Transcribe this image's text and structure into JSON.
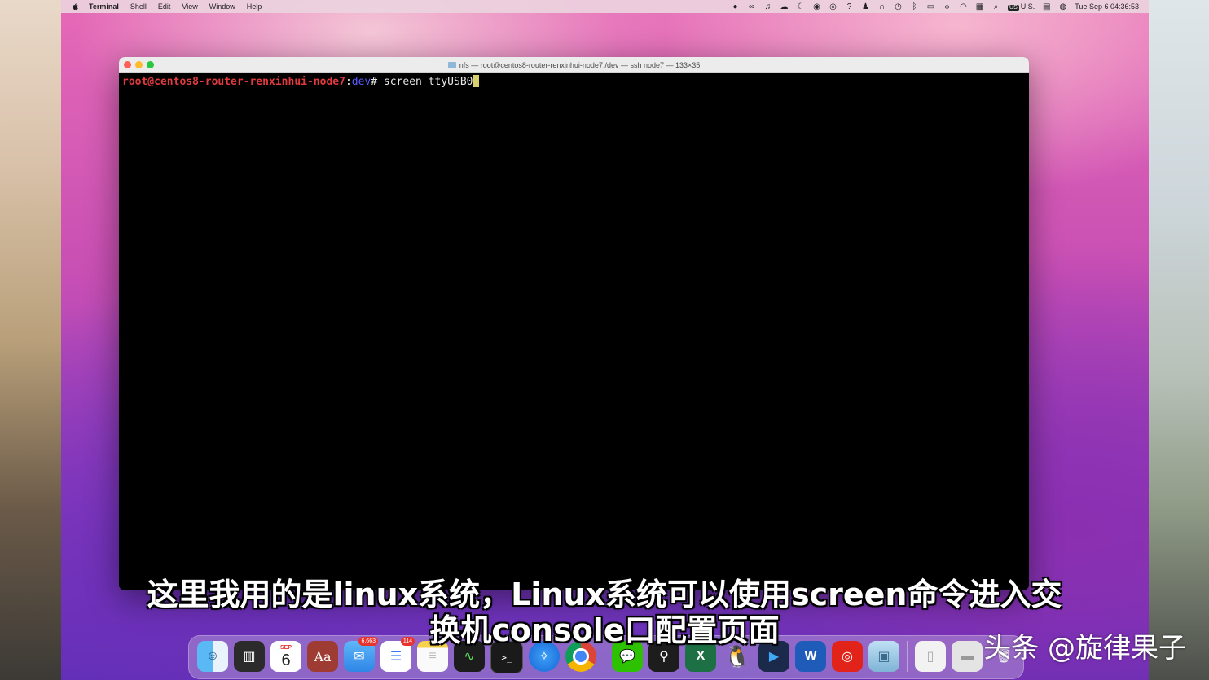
{
  "menubar": {
    "app_name": "Terminal",
    "menus": [
      "Shell",
      "Edit",
      "View",
      "Window",
      "Help"
    ],
    "input_source": "U.S.",
    "input_badge": "US",
    "datetime": "Tue Sep 6  04:36:53"
  },
  "window": {
    "title": "nfs — root@centos8-router-renxinhui-node7:/dev — ssh node7 — 133×35"
  },
  "terminal": {
    "prompt_user_host": "root@centos8-router-renxinhui-node7",
    "prompt_sep": ":",
    "prompt_dir": "dev",
    "prompt_hash": "# ",
    "command": "screen ttyUSB0"
  },
  "dock": {
    "calendar_month": "SEP",
    "calendar_day": "6",
    "dictionary_label": "Aa",
    "mail_badge": "6,663",
    "reminders_badge": "114",
    "word_label": "W",
    "excel_label": "X"
  },
  "subtitle": {
    "line1": "这里我用的是linux系统，Linux系统可以使用screen命令进入交",
    "line2": "换机console口配置页面"
  },
  "watermark": "头条 @旋律果子",
  "colors": {
    "prompt_user": "#e0393e",
    "prompt_dir": "#5b5bff",
    "cursor": "#d9d16b"
  }
}
